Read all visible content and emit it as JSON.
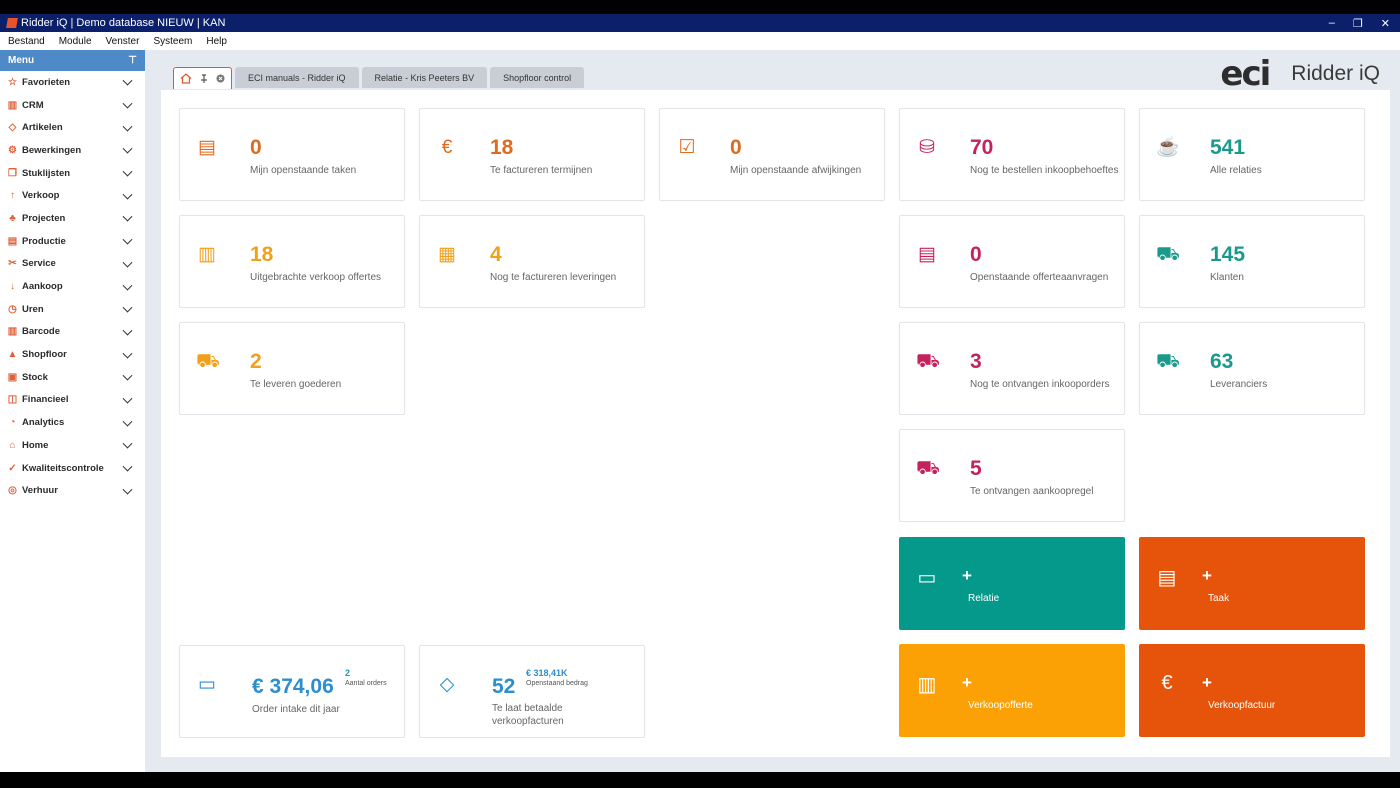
{
  "window": {
    "title": "Ridder iQ | Demo database NIEUW | KAN",
    "controls": [
      "–",
      "❐",
      "✕"
    ]
  },
  "menubar": [
    "Bestand",
    "Module",
    "Venster",
    "Systeem",
    "Help"
  ],
  "sidebar": {
    "header": "Menu",
    "pin": "⊤",
    "items": [
      {
        "label": "Favorieten",
        "icon": "☆"
      },
      {
        "label": "CRM",
        "icon": "▥"
      },
      {
        "label": "Artikelen",
        "icon": "◇"
      },
      {
        "label": "Bewerkingen",
        "icon": "⚙"
      },
      {
        "label": "Stuklijsten",
        "icon": "❐"
      },
      {
        "label": "Verkoop",
        "icon": "↑"
      },
      {
        "label": "Projecten",
        "icon": "♣"
      },
      {
        "label": "Productie",
        "icon": "▤"
      },
      {
        "label": "Service",
        "icon": "✂"
      },
      {
        "label": "Aankoop",
        "icon": "↓"
      },
      {
        "label": "Uren",
        "icon": "◷"
      },
      {
        "label": "Barcode",
        "icon": "▥"
      },
      {
        "label": "Shopfloor",
        "icon": "▲"
      },
      {
        "label": "Stock",
        "icon": "▣"
      },
      {
        "label": "Financieel",
        "icon": "◫"
      },
      {
        "label": "Analytics",
        "icon": "◔"
      },
      {
        "label": "Home",
        "icon": "⌂"
      },
      {
        "label": "Kwaliteitscontrole",
        "icon": "✓"
      },
      {
        "label": "Verhuur",
        "icon": "◎"
      }
    ]
  },
  "tabs": [
    {
      "label": "ECI manuals - Ridder iQ"
    },
    {
      "label": "Relatie - Kris Peeters BV"
    },
    {
      "label": "Shopfloor control"
    }
  ],
  "logo": {
    "eci": "eci",
    "product": "Ridder iQ"
  },
  "cards": [
    {
      "value": "0",
      "label": "Mijn openstaande taken",
      "icon": "▤",
      "color": "orange"
    },
    {
      "value": "18",
      "label": "Te factureren termijnen",
      "icon": "€",
      "color": "orange"
    },
    {
      "value": "0",
      "label": "Mijn openstaande afwijkingen",
      "icon": "☑",
      "color": "orange"
    },
    {
      "value": "70",
      "label": "Nog te bestellen inkoopbehoeftes",
      "icon": "⛁",
      "color": "pink"
    },
    {
      "value": "541",
      "label": "Alle relaties",
      "icon": "☕",
      "color": "teal"
    },
    {
      "value": "18",
      "label": "Uitgebrachte verkoop offertes",
      "icon": "▥",
      "color": "amber"
    },
    {
      "value": "4",
      "label": "Nog te factureren leveringen",
      "icon": "▦",
      "color": "amber"
    },
    {
      "value": "0",
      "label": "Openstaande offerteaanvragen",
      "icon": "▤",
      "color": "pink"
    },
    {
      "value": "145",
      "label": "Klanten",
      "icon": "⛟",
      "color": "teal"
    },
    {
      "value": "2",
      "label": "Te leveren goederen",
      "icon": "⛟",
      "color": "amber"
    },
    {
      "value": "3",
      "label": "Nog te ontvangen inkooporders",
      "icon": "⛟",
      "color": "pink"
    },
    {
      "value": "63",
      "label": "Leveranciers",
      "icon": "⛟",
      "color": "teal"
    },
    {
      "value": "5",
      "label": "Te ontvangen aankoopregel",
      "icon": "⛟",
      "color": "pink"
    }
  ],
  "actions": [
    {
      "label": "Relatie",
      "plus": "+",
      "icon": "▭",
      "bg": "#04998a"
    },
    {
      "label": "Taak",
      "plus": "+",
      "icon": "▤",
      "bg": "#e5540a"
    },
    {
      "label": "Verkoopofferte",
      "plus": "+",
      "icon": "▥",
      "bg": "#fba106"
    },
    {
      "label": "Verkoopfactuur",
      "plus": "+",
      "icon": "€",
      "bg": "#e5540a"
    }
  ],
  "kpis": {
    "order_intake": {
      "value": "€ 374,06",
      "label": "Order intake dit jaar",
      "sup": "2",
      "sup_label": "Aantal orders",
      "icon": "▭"
    },
    "late_invoices": {
      "value": "52",
      "label_1": "Te laat betaalde",
      "label_2": "verkoopfacturen",
      "sup": "€ 318,41K",
      "sup_label": "Openstaand bedrag",
      "icon": "◇"
    }
  },
  "colors": {
    "orange": "#e06a1f",
    "amber": "#f0a01a",
    "pink": "#c6215f",
    "teal": "#1a9a8c",
    "blue": "#2c8dcf",
    "titlebar": "#0b1f6b",
    "sidebar_header": "#4d8ac7"
  }
}
